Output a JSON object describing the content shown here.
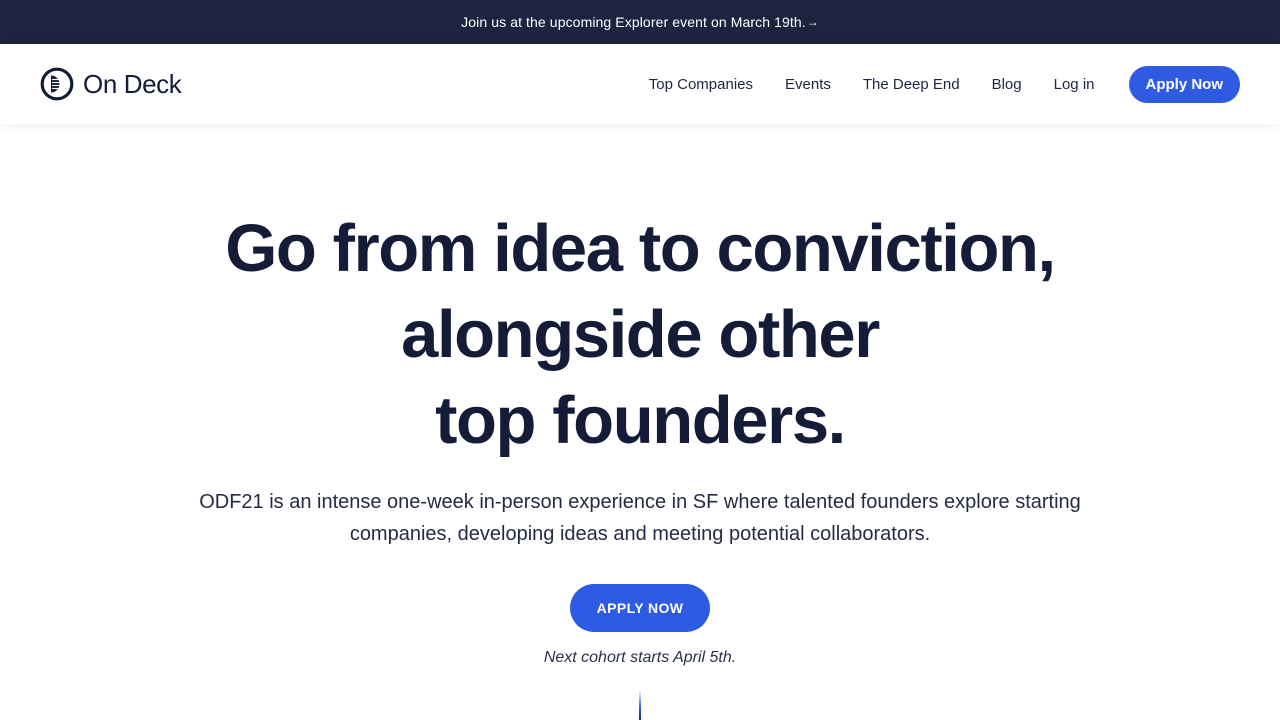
{
  "announcement": {
    "text": "Join us at the upcoming Explorer event on March 19th.",
    "arrow": "→"
  },
  "header": {
    "logo_text": "On Deck",
    "nav": [
      {
        "label": "Top Companies"
      },
      {
        "label": "Events"
      },
      {
        "label": "The Deep End"
      },
      {
        "label": "Blog"
      },
      {
        "label": "Log in"
      }
    ],
    "apply_label": "Apply Now"
  },
  "hero": {
    "headline_lines": [
      "Go from idea to conviction,",
      "alongside other",
      "top founders."
    ],
    "subcopy_lines": [
      "ODF21 is an intense one-week in-person experience in SF where talented founders explore starting",
      "companies, developing ideas and meeting potential collaborators."
    ],
    "cta_label": "APPLY NOW",
    "cohort_note": "Next cohort starts April 5th."
  },
  "colors": {
    "announcement_bg": "#1c2440",
    "accent": "#2e5be2",
    "heading": "#141c38"
  }
}
